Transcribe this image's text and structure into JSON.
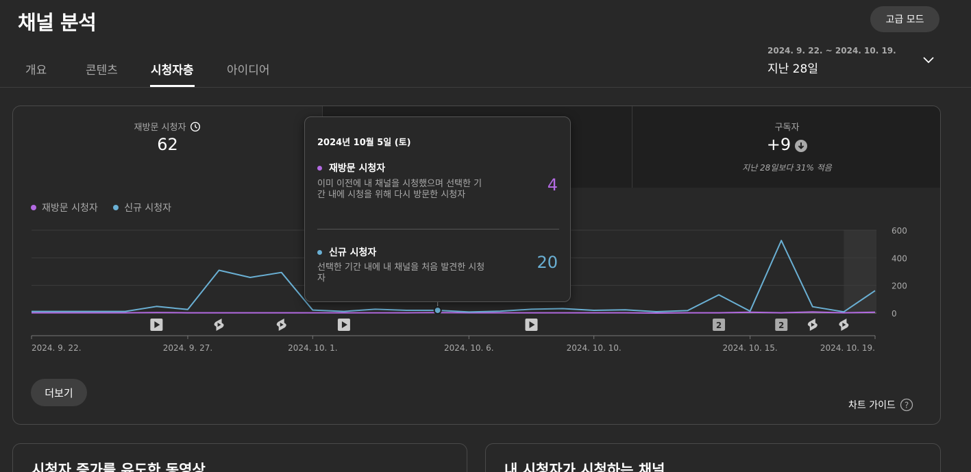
{
  "header": {
    "title": "채널 분석",
    "advanced_mode": "고급 모드",
    "date_range": "2024. 9. 22. ~ 2024. 10. 19.",
    "period": "지난 28일"
  },
  "tabs": [
    {
      "label": "개요",
      "active": false
    },
    {
      "label": "콘텐츠",
      "active": false
    },
    {
      "label": "시청자층",
      "active": true
    },
    {
      "label": "아이디어",
      "active": false
    }
  ],
  "metrics": [
    {
      "label": "재방문 시청자",
      "value": "62",
      "icon": "clock-icon"
    },
    {
      "label": "",
      "value": "",
      "sub": ""
    },
    {
      "label": "구독자",
      "value": "+9",
      "sub": "지난 28일보다 31% 적음",
      "icon": "arrow-down-circle-icon"
    }
  ],
  "legend": [
    {
      "name": "재방문 시청자",
      "color": "#b36ae2"
    },
    {
      "name": "신규 시청자",
      "color": "#6ab0d4"
    }
  ],
  "chart_data": {
    "type": "line",
    "x": [
      "2024-09-22",
      "2024-09-23",
      "2024-09-24",
      "2024-09-25",
      "2024-09-26",
      "2024-09-27",
      "2024-09-28",
      "2024-09-29",
      "2024-09-30",
      "2024-10-01",
      "2024-10-02",
      "2024-10-03",
      "2024-10-04",
      "2024-10-05",
      "2024-10-06",
      "2024-10-07",
      "2024-10-08",
      "2024-10-09",
      "2024-10-10",
      "2024-10-11",
      "2024-10-12",
      "2024-10-13",
      "2024-10-14",
      "2024-10-15",
      "2024-10-16",
      "2024-10-17",
      "2024-10-18",
      "2024-10-19"
    ],
    "series": [
      {
        "name": "재방문 시청자",
        "color": "#b36ae2",
        "values": [
          2,
          2,
          2,
          2,
          4,
          2,
          2,
          2,
          2,
          2,
          2,
          2,
          2,
          4,
          2,
          2,
          2,
          2,
          2,
          2,
          0,
          2,
          2,
          6,
          2,
          8,
          2,
          6
        ]
      },
      {
        "name": "신규 시청자",
        "color": "#6ab0d4",
        "values": [
          12,
          12,
          12,
          12,
          48,
          26,
          310,
          258,
          294,
          22,
          12,
          28,
          20,
          20,
          8,
          14,
          28,
          32,
          20,
          24,
          10,
          18,
          132,
          14,
          525,
          46,
          9,
          162
        ]
      }
    ],
    "x_ticks": [
      "2024. 9. 22.",
      "2024. 9. 27.",
      "2024. 10. 1.",
      "2024. 10. 6.",
      "2024. 10. 10.",
      "2024. 10. 15.",
      "2024. 10. 19."
    ],
    "x_tick_index": [
      0,
      5,
      9,
      14,
      18,
      23,
      27
    ],
    "y_ticks": [
      "600",
      "400",
      "200",
      "0"
    ],
    "ylim": [
      0,
      600
    ],
    "highlight_index": 13,
    "grid": true,
    "upload_markers": [
      {
        "index": 4,
        "kind": "video"
      },
      {
        "index": 6,
        "kind": "shorts"
      },
      {
        "index": 8,
        "kind": "shorts"
      },
      {
        "index": 10,
        "kind": "video"
      },
      {
        "index": 16,
        "kind": "video"
      },
      {
        "index": 22,
        "kind": "count",
        "count": "2"
      },
      {
        "index": 24,
        "kind": "count",
        "count": "2"
      },
      {
        "index": 25,
        "kind": "shorts"
      },
      {
        "index": 26,
        "kind": "shorts"
      }
    ]
  },
  "tooltip": {
    "date": "2024년 10월 5일 (토)",
    "rows": [
      {
        "title": "재방문 시청자",
        "desc": "이미 이전에 내 채널을 시청했으며 선택한 기간 내에 시청을 위해 다시 방문한 시청자",
        "value": "4",
        "color": "#b36ae2"
      },
      {
        "title": "신규 시청자",
        "desc": "선택한 기간 내에 내 채널을 처음 발견한 시청자",
        "value": "20",
        "color": "#6ab0d4"
      }
    ]
  },
  "buttons": {
    "more": "더보기",
    "chart_guide": "차트 가이드"
  },
  "bottom_cards": [
    {
      "title": "시청자 증가를 유도한 동영상"
    },
    {
      "title": "내 시청자가 시청하는 채널"
    }
  ]
}
